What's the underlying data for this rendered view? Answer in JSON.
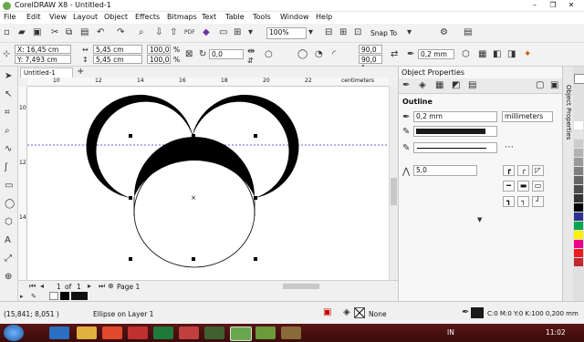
{
  "app": {
    "title": "CorelDRAW X8 - Untitled-1",
    "title_prefix": "CorelDRAW X8"
  },
  "menu": [
    "File",
    "Edit",
    "View",
    "Layout",
    "Object",
    "Effects",
    "Bitmaps",
    "Text",
    "Table",
    "Tools",
    "Window",
    "Help"
  ],
  "toolbar": {
    "zoom": "100%",
    "snap_label": "Snap To",
    "outline_width": "0,2 mm"
  },
  "properties": {
    "x": "X: 16,45 cm",
    "y": "Y: 7,493 cm",
    "width": "5,45 cm",
    "height": "5,45 cm",
    "scale_w": "100,0",
    "scale_h": "100,0",
    "pct": "%",
    "rotation": "0,0",
    "angle_start": "90,0 °",
    "angle_end": "90,0 °",
    "outline": "0,2 mm"
  },
  "document": {
    "tab": "Untitled-1",
    "ruler_unit": "centimeters",
    "ruler_ticks": [
      "10",
      "12",
      "14",
      "16",
      "18",
      "20",
      "22"
    ],
    "vruler_ticks": [
      "10",
      "12",
      "14"
    ]
  },
  "page_nav": {
    "current": "1",
    "of": "of",
    "total": "1",
    "page_tab": "Page 1"
  },
  "panel": {
    "title": "Object Properties",
    "section": "Outline",
    "width_value": "0,2 mm",
    "units": "millimeters",
    "miter": "5,0",
    "vertical_tab": "Object Properties"
  },
  "status": {
    "coords": "(15,841; 8,051 )",
    "object": "Ellipse on Layer 1",
    "fill": "None",
    "outline_info": "C:0 M:0 Y:0 K:100  0,200 mm"
  },
  "taskbar": {
    "lang": "IN",
    "time": "11:02"
  },
  "colors": {
    "accent": "#1e5aa0",
    "guideline": "#3030c0",
    "taskbar": "#4a1010"
  }
}
